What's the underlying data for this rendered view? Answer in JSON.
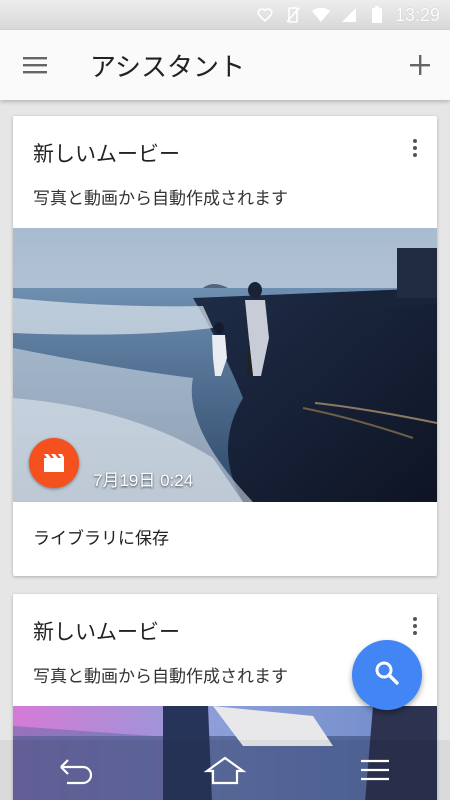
{
  "status": {
    "time": "13:29",
    "battery_level": "54"
  },
  "appbar": {
    "title": "アシスタント"
  },
  "cards": [
    {
      "title": "新しいムービー",
      "subtitle": "写真と動画から自動作成されます",
      "date": "7月19日 0:24",
      "action": "ライブラリに保存"
    },
    {
      "title": "新しいムービー",
      "subtitle": "写真と動画から自動作成されます"
    }
  ],
  "colors": {
    "accent": "#4285f4",
    "movie_badge": "#f4511e"
  }
}
